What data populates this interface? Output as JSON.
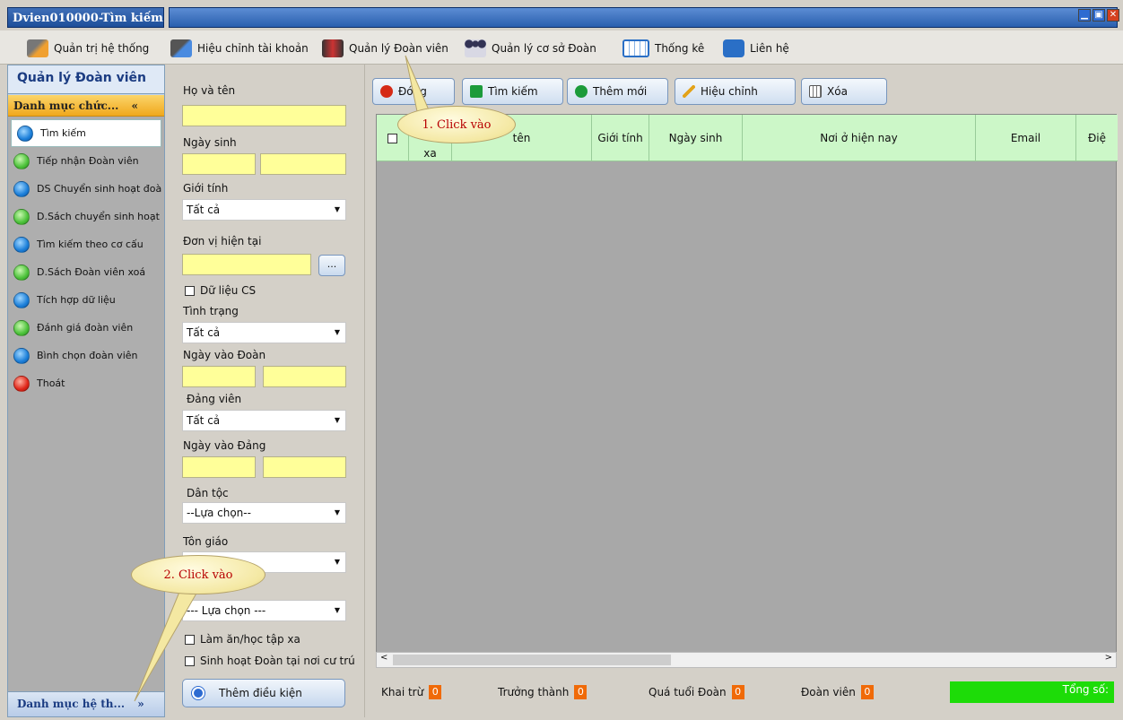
{
  "window": {
    "title": "Dvien010000-Tìm kiếm"
  },
  "menubar": {
    "items": [
      {
        "label": "Quản trị hệ thống",
        "icon": "tools-icon"
      },
      {
        "label": "Hiệu chỉnh tài khoản",
        "icon": "user-edit-icon"
      },
      {
        "label": "Quản lý Đoàn viên",
        "icon": "users-group-icon"
      },
      {
        "label": "Quản lý cơ sở Đoàn",
        "icon": "network-icon"
      },
      {
        "label": "Thống kê",
        "icon": "calendar-icon"
      },
      {
        "label": "Liên hệ",
        "icon": "contact-icon"
      }
    ]
  },
  "sidebar": {
    "title": "Quản lý Đoàn viên",
    "section": "Danh mục chức...",
    "footer": "Danh mục hệ th...",
    "items": [
      {
        "label": "Tìm kiếm",
        "dot": "blue"
      },
      {
        "label": "Tiếp nhận Đoàn viên",
        "dot": "green"
      },
      {
        "label": "DS Chuyển sinh hoạt đoà",
        "dot": "blue"
      },
      {
        "label": "D.Sách chuyển sinh hoạt",
        "dot": "green"
      },
      {
        "label": "Tìm kiếm theo cơ cấu",
        "dot": "blue"
      },
      {
        "label": "D.Sách Đoàn viên xoá",
        "dot": "green"
      },
      {
        "label": "Tích hợp dữ liệu",
        "dot": "blue"
      },
      {
        "label": "Đánh giá đoàn viên",
        "dot": "green"
      },
      {
        "label": "Bình chọn đoàn viên",
        "dot": "blue"
      },
      {
        "label": "Thoát",
        "dot": "red"
      }
    ]
  },
  "form": {
    "ho_ten": "Họ và tên",
    "ngay_sinh": "Ngày sinh",
    "gioi_tinh": "Giới tính",
    "gioi_tinh_value": "Tất cả",
    "don_vi": "Đơn vị hiện tại",
    "dots": "...",
    "du_lieu_cs": "Dữ liệu CS",
    "tinh_trang": "Tình trạng",
    "tinh_trang_value": "Tất cả",
    "ngay_vao_doan": "Ngày vào Đoàn",
    "dang_vien": "Đảng viên",
    "dang_vien_value": "Tất cả",
    "ngay_vao_dang": "Ngày vào Đảng",
    "dan_toc": "Dân tộc",
    "dan_toc_value": "--Lựa chọn--",
    "ton_giao": "Tôn giáo",
    "select_last_value": "--- Lựa chọn ---",
    "lam_an": "Làm ăn/học tập xa",
    "sinh_hoat": "Sinh hoạt Đoàn tại nơi cư trú",
    "add_condition": "Thêm điều kiện"
  },
  "toolbar": {
    "dong": "Đóng",
    "tim_kiem": "Tìm kiếm",
    "them_moi": "Thêm mới",
    "hieu_chinh": "Hiệu chỉnh",
    "xoa": "Xóa"
  },
  "grid": {
    "columns": [
      "xa",
      "tên",
      "Giới tính",
      "Ngày sinh",
      "Nơi ở hiện nay",
      "Email",
      "Điệ"
    ]
  },
  "status": {
    "khai_tru": "Khai trừ",
    "khai_tru_count": "0",
    "truong_thanh": "Trưởng thành",
    "truong_thanh_count": "0",
    "qua_tuoi": "Quá tuổi Đoàn",
    "qua_tuoi_count": "0",
    "doan_vien": "Đoàn viên",
    "doan_vien_count": "0",
    "tong_so": "Tổng số:"
  },
  "annotations": {
    "callout1": "1. Click vào",
    "callout2": "2. Click vào"
  },
  "colors": {
    "accent": "#1b3c82",
    "highlight_input": "#ffff99",
    "grid_header": "#ccf7c8",
    "total_bar": "#1ddc08",
    "badge": "#f06a08",
    "callout_text": "#b80000"
  }
}
